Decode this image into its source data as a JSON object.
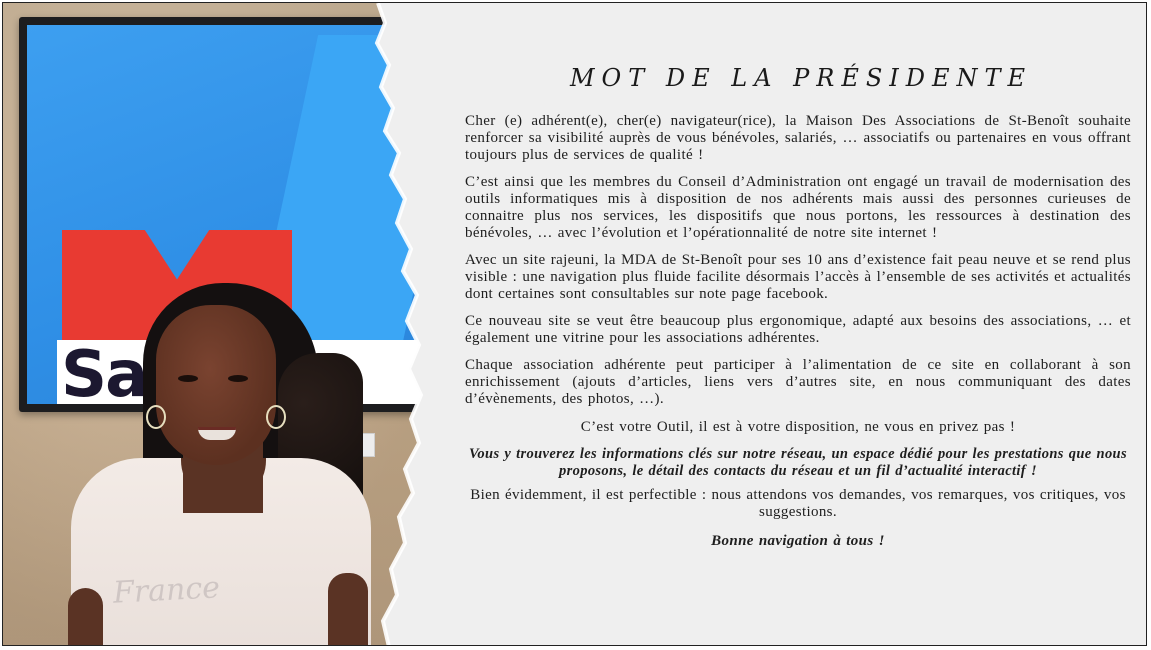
{
  "photo": {
    "screen_band_text": "Saint-B",
    "shirt_text": "France"
  },
  "article": {
    "title": "MOT DE LA PRÉSIDENTE",
    "paragraphs": [
      "Cher (e) adhérent(e), cher(e) navigateur(rice), la Maison Des Associations de St-Benoît souhaite renforcer sa visibilité auprès de vous bénévoles, salariés, … associatifs ou partenaires en vous offrant toujours plus de services de qualité !",
      "C’est ainsi que les membres du Conseil d’Administration ont engagé un travail de modernisation des outils informatiques mis à disposition de nos adhérents mais aussi des personnes curieuses de connaitre plus nos services, les dispositifs que nous portons, les ressources à destination des bénévoles, … avec l’évolution et l’opérationnalité de notre site internet !",
      " Avec un site rajeuni, la MDA de St-Benoît pour ses 10 ans d’existence fait peau neuve et se rend plus visible : une navigation plus fluide facilite désormais l’accès à l’ensemble de ses activités et actualités dont certaines sont consultables sur note page facebook.",
      "Ce nouveau site se veut être beaucoup plus ergonomique, adapté aux besoins des associations, … et également une vitrine pour les associations adhérentes.",
      "Chaque association adhérente peut participer à l’alimentation de ce site en collaborant à son enrichissement (ajouts d’articles, liens vers d’autres site, en nous communiquant des dates d’évènements, des photos, …).",
      "C’est votre Outil, il est à votre disposition, ne vous en privez pas !",
      "Vous y trouverez les informations clés sur notre réseau, un espace dédié pour les prestations que nous proposons, le détail des contacts du réseau et un fil d’actualité interactif !",
      "Bien évidemment, il est perfectible : nous attendons vos demandes, vos remarques, vos critiques, vos suggestions.",
      "Bonne navigation à tous !"
    ]
  },
  "colors": {
    "paper": "#efefef",
    "screen_blue": "#2f8fe6",
    "logo_red": "#e83a32",
    "text": "#1e1e1e"
  }
}
